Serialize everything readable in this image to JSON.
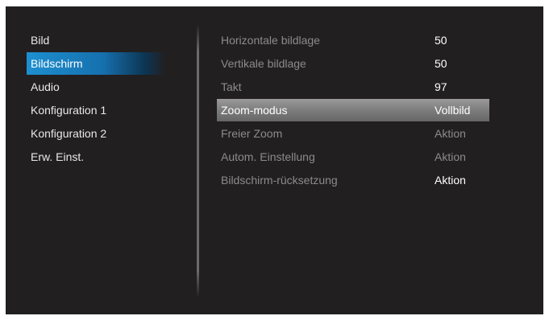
{
  "menu": {
    "items": [
      {
        "label": "Bild"
      },
      {
        "label": "Bildschirm"
      },
      {
        "label": "Audio"
      },
      {
        "label": "Konfiguration 1"
      },
      {
        "label": "Konfiguration 2"
      },
      {
        "label": "Erw. Einst."
      }
    ],
    "active_index": 1
  },
  "settings": {
    "rows": [
      {
        "label": "Horizontale bildlage",
        "value": "50"
      },
      {
        "label": "Vertikale bildlage",
        "value": "50"
      },
      {
        "label": "Takt",
        "value": "97"
      },
      {
        "label": "Zoom-modus",
        "value": "Vollbild"
      },
      {
        "label": "Freier Zoom",
        "value": "Aktion"
      },
      {
        "label": "Autom. Einstellung",
        "value": "Aktion"
      },
      {
        "label": "Bildschirm-rücksetzung",
        "value": "Aktion"
      }
    ],
    "selected_index": 3
  },
  "colors": {
    "background": "#221f20",
    "accent": "#1670ae",
    "highlight": "#7d7d7d"
  }
}
